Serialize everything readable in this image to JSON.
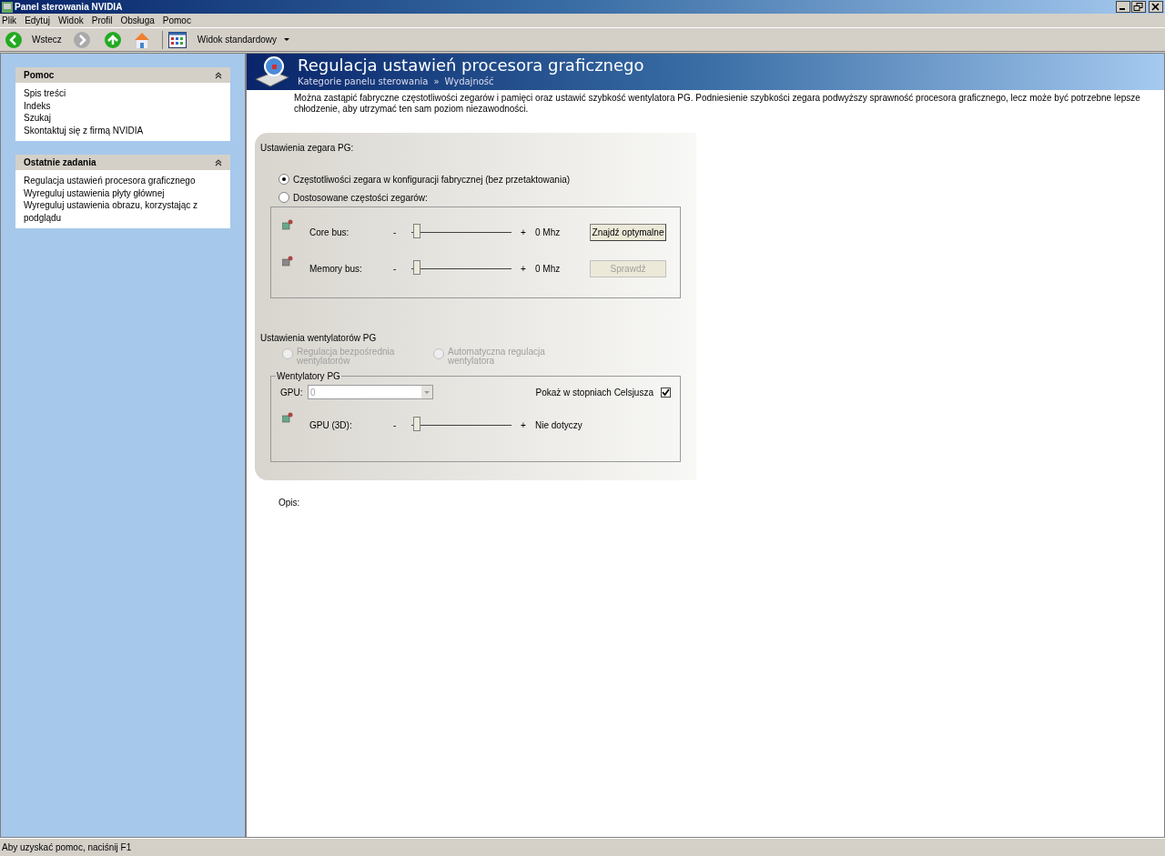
{
  "window": {
    "title": "Panel sterowania NVIDIA"
  },
  "menu": [
    {
      "label": "Plik"
    },
    {
      "label": "Edytuj"
    },
    {
      "label": "Widok"
    },
    {
      "label": "Profil"
    },
    {
      "label": "Obsługa"
    },
    {
      "label": "Pomoc"
    }
  ],
  "toolbar": {
    "back": {
      "label": "Wstecz",
      "disabled": false
    },
    "forward": {
      "disabled": true
    },
    "view": {
      "label": "Widok standardowy"
    }
  },
  "sidebar": {
    "panels": [
      {
        "title": "Pomoc",
        "expanded": true,
        "items": [
          "Spis treści",
          "Indeks",
          "Szukaj",
          "Skontaktuj się z firmą NVIDIA"
        ]
      },
      {
        "title": "Ostatnie zadania",
        "expanded": true,
        "items": [
          "Regulacja ustawień procesora graficznego",
          "Wyreguluj ustawienia płyty głównej",
          "Wyreguluj ustawienia obrazu, korzystając z podglądu"
        ]
      }
    ]
  },
  "header": {
    "title": "Regulacja ustawień procesora graficznego",
    "breadcrumb": [
      "Kategorie panelu sterowania",
      "»",
      "Wydajność"
    ]
  },
  "description": "Można zastąpić fabryczne częstotliwości zegarów i pamięci oraz ustawić szybkość wentylatora PG. Podniesienie szybkości zegara podwyższy sprawność procesora graficznego, lecz może być potrzebne lepsze chłodzenie, aby utrzymać ten sam poziom niezawodności.",
  "clock": {
    "title": "Ustawienia zegara PG:",
    "options": [
      {
        "label": "Częstotliwości zegara w konfiguracji fabrycznej (bez przetaktowania)",
        "selected": true
      },
      {
        "label": "Dostosowane częstości zegarów:",
        "selected": false
      }
    ],
    "rows": [
      {
        "label": "Core bus:",
        "minus": "-",
        "plus": "+",
        "level": 0.02,
        "reading": "0 Mhz",
        "button": {
          "label": "Znajdź optymalne",
          "disabled": false
        }
      },
      {
        "label": "Memory bus:",
        "minus": "-",
        "plus": "+",
        "level": 0.02,
        "reading": "0 Mhz",
        "button": {
          "label": "Sprawdź",
          "disabled": true
        }
      }
    ]
  },
  "fans": {
    "title": "Ustawienia wentylatorów PG",
    "options": [
      {
        "label": "Regulacja bezpośrednia wentylatorów",
        "selected": false,
        "disabled": true
      },
      {
        "label": "Automatyczna regulacja wentylatora",
        "selected": false,
        "disabled": true
      }
    ],
    "group": {
      "title": "Wentylatory PG",
      "gpu_label": "GPU:",
      "gpu_value": "0",
      "gpu_disabled": true,
      "celsius": {
        "label": "Pokaż w stopniach Celsjusza",
        "checked": true
      },
      "row": {
        "label": "GPU (3D):",
        "minus": "-",
        "plus": "+",
        "level": 0.02,
        "reading": "Nie dotyczy"
      }
    }
  },
  "opis": "Opis:",
  "status_bar": "Aby uzyskać pomoc, naciśnij F1"
}
